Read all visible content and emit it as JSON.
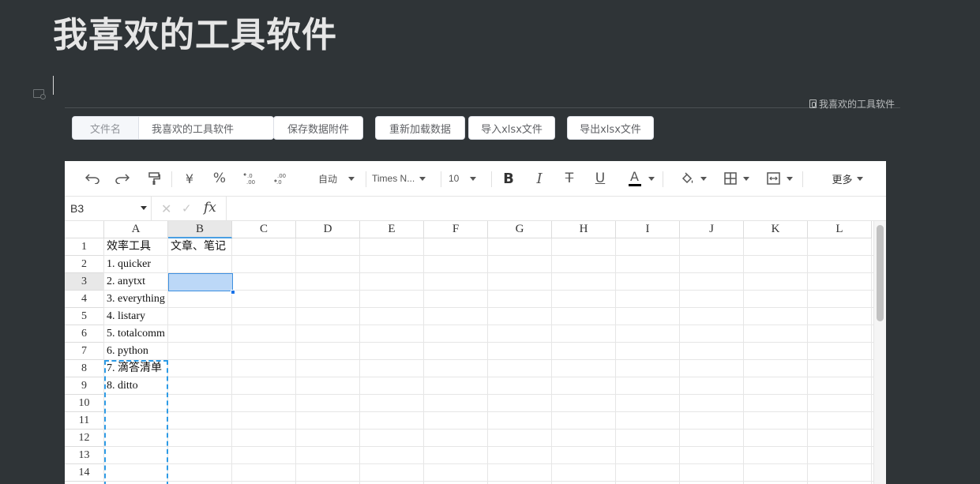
{
  "page": {
    "title": "我喜欢的工具软件",
    "attachment_name": "我喜欢的工具软件"
  },
  "file_controls": {
    "filename_label": "文件名",
    "filename_value": "我喜欢的工具软件",
    "save_label": "保存数据附件",
    "reload_label": "重新加载数据",
    "import_label": "导入xlsx文件",
    "export_label": "导出xlsx文件"
  },
  "toolbar": {
    "currency_symbol": "¥",
    "percent_symbol": "%",
    "number_format": "自动",
    "font_family": "Times N...",
    "font_size": "10",
    "bold_glyph": "B",
    "italic_glyph": "I",
    "strike_glyph": "T",
    "underline_glyph": "U",
    "text_color_glyph": "A",
    "text_color": "#000000",
    "more_label": "更多"
  },
  "formula_bar": {
    "cell_ref": "B3",
    "cancel_glyph": "✕",
    "confirm_glyph": "✓",
    "fx_label": "fx"
  },
  "sheet": {
    "selected_column": "B",
    "selected_row": "3",
    "columns": [
      "A",
      "B",
      "C",
      "D",
      "E",
      "F",
      "G",
      "H",
      "I",
      "J",
      "K",
      "L"
    ],
    "rows": [
      "1",
      "2",
      "3",
      "4",
      "5",
      "6",
      "7",
      "8",
      "9",
      "10",
      "11",
      "12",
      "13",
      "14"
    ],
    "cells": {
      "A1": "效率工具",
      "B1": "文章、笔记",
      "A2": "1. quicker",
      "A3": "2. anytxt",
      "A4": "3. everything",
      "A5": "4. listary",
      "A6": "5. totalcomm",
      "A7": "6. python",
      "A8": "7. 滴答清单",
      "A9": "8. ditto"
    },
    "selection_color": "#bcd8f7",
    "accent_color": "#2d9be6"
  }
}
